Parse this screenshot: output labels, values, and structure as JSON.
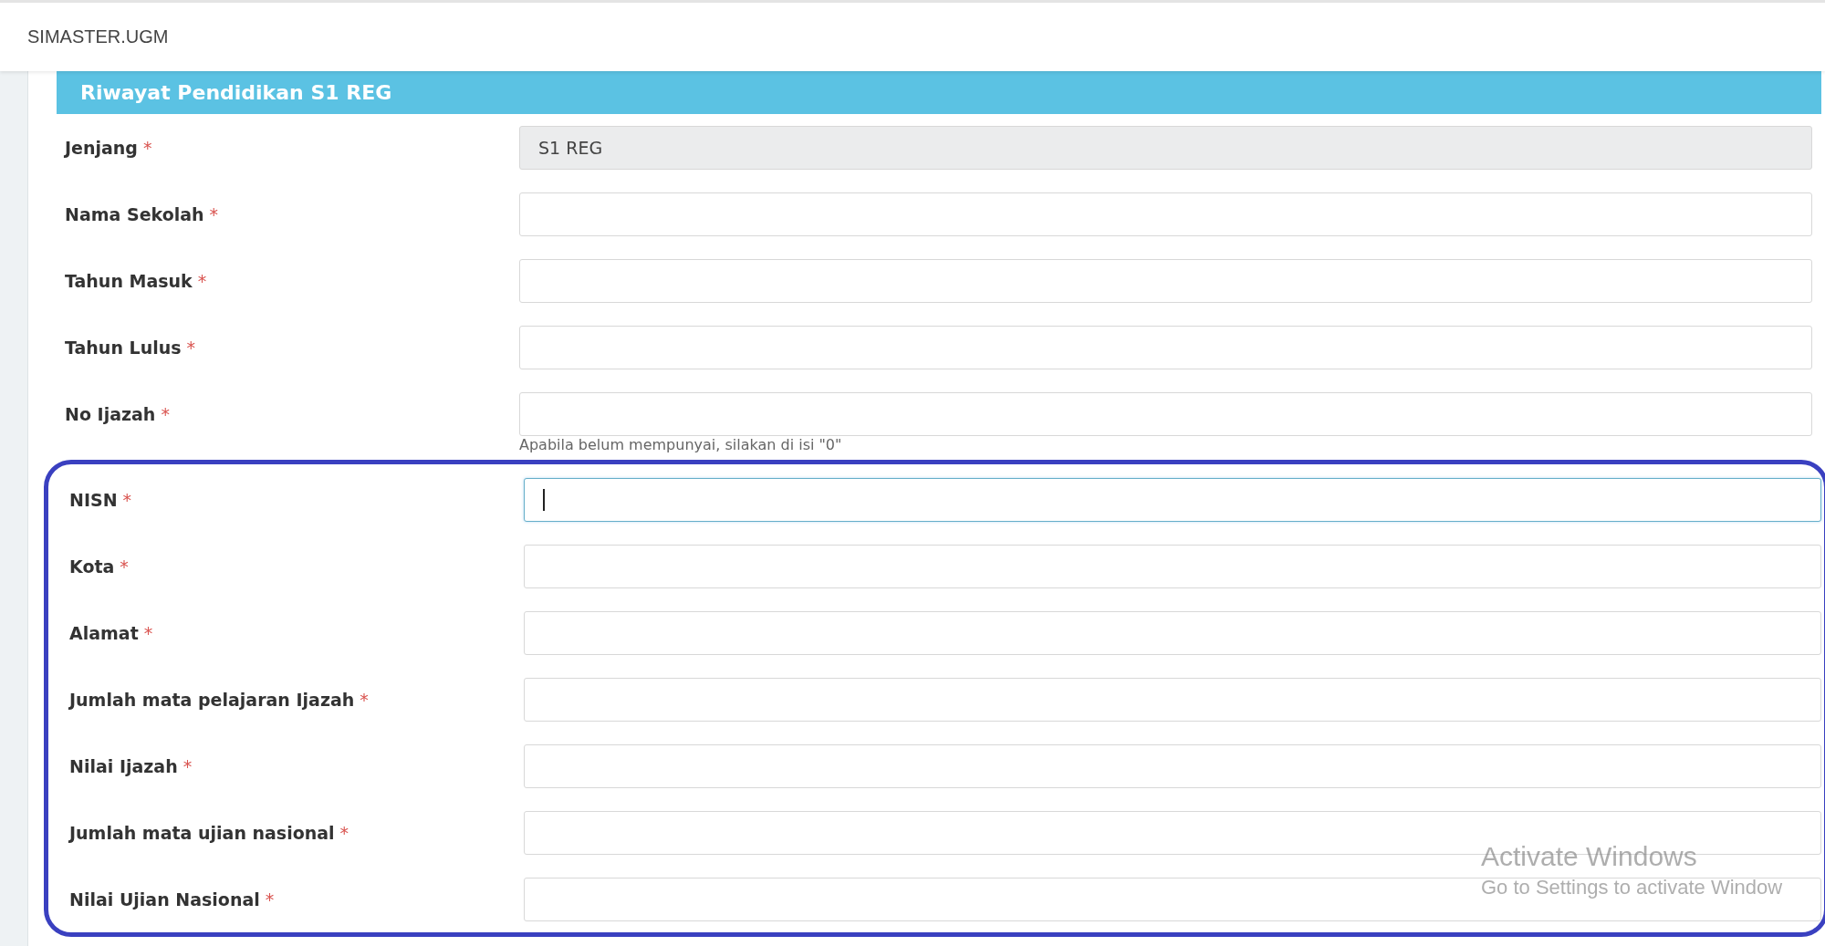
{
  "app_title": "SIMASTER.UGM",
  "section_title": "Riwayat Pendidikan S1 REG",
  "fields": [
    {
      "kind": "readonly",
      "label": "Jenjang",
      "mark": "*",
      "value": "S1 REG",
      "focused": false
    },
    {
      "kind": "text",
      "label": "Nama Sekolah",
      "mark": "*",
      "focused": false
    },
    {
      "kind": "text",
      "label": "Tahun Masuk",
      "mark": "*",
      "focused": false
    },
    {
      "kind": "text",
      "label": "Tahun Lulus",
      "mark": "*",
      "focused": false
    },
    {
      "kind": "text",
      "label": "No Ijazah",
      "mark": "*",
      "focused": false,
      "help": "Apabila belum mempunyai, silakan di isi \"0\""
    }
  ],
  "highlighted_fields": [
    {
      "kind": "text",
      "label": "NISN",
      "mark": "*",
      "focused": true
    },
    {
      "kind": "text",
      "label": "Kota",
      "mark": "*",
      "focused": false
    },
    {
      "kind": "text",
      "label": "Alamat",
      "mark": "*",
      "focused": false
    },
    {
      "kind": "text",
      "label": "Jumlah mata pelajaran Ijazah",
      "mark": "*",
      "focused": false
    },
    {
      "kind": "text",
      "label": "Nilai Ijazah",
      "mark": "*",
      "focused": false
    },
    {
      "kind": "text",
      "label": "Jumlah mata ujian nasional",
      "mark": "*",
      "focused": false
    },
    {
      "kind": "text",
      "label": "Nilai Ujian Nasional",
      "mark": "*",
      "focused": false
    }
  ],
  "os_overlay": {
    "title": "Activate Windows",
    "subtitle": "Go to Settings to activate Window"
  }
}
